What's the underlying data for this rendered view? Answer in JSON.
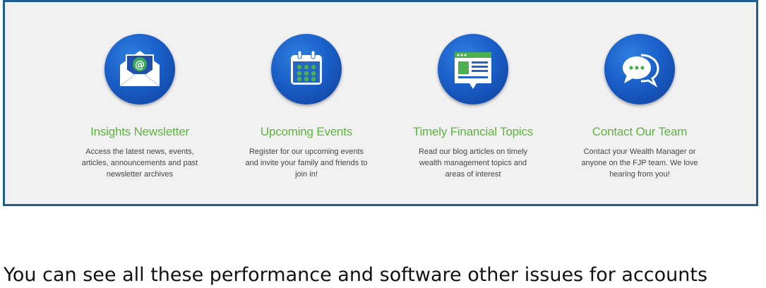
{
  "features": [
    {
      "title": "Insights Newsletter",
      "lines": [
        "Access the latest news, events,",
        "articles, announcements and past",
        "newsletter archives"
      ],
      "icon": "envelope-at-icon"
    },
    {
      "title": "Upcoming Events",
      "lines": [
        "Register for our upcoming events",
        "and invite your family and friends to",
        "join in!"
      ],
      "icon": "calendar-icon"
    },
    {
      "title": "Timely Financial Topics",
      "lines": [
        "Read our blog articles on timely",
        "wealth management topics and",
        "areas of interest"
      ],
      "icon": "blog-article-icon"
    },
    {
      "title": "Contact Our Team",
      "lines": [
        "Contact your Wealth Manager or",
        "anyone on the FJP team. We love",
        "hearing from you!"
      ],
      "icon": "chat-bubbles-icon"
    }
  ],
  "bottom_text": "You can see all these performance and software other issues for accounts",
  "colors": {
    "border": "#1f5e8e",
    "panel_bg": "#f1f1f1",
    "title_green": "#5bb53a",
    "icon_blue": "#1a5fc8",
    "icon_accent_green": "#4caf50"
  }
}
